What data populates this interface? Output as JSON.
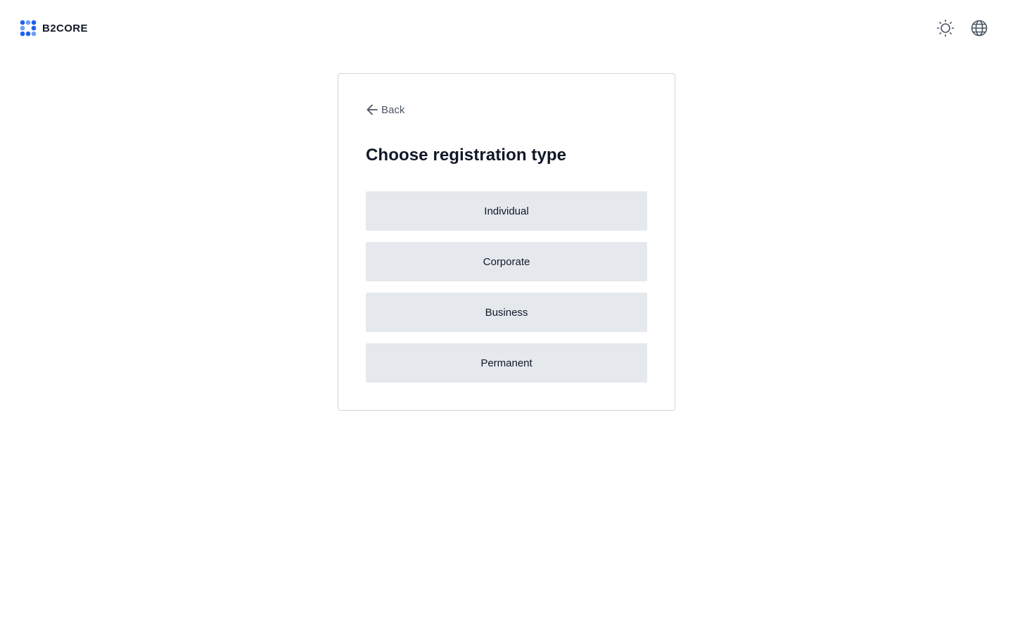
{
  "header": {
    "brand_name": "B2CORE",
    "brand_color": "#1d63f0",
    "icons": {
      "logo": "b2core-logo-icon",
      "theme": "sun-icon",
      "language": "globe-icon"
    }
  },
  "card": {
    "back_label": "Back",
    "back_icon": "arrow-left-icon",
    "title": "Choose registration type",
    "options": [
      {
        "label": "Individual"
      },
      {
        "label": "Corporate"
      },
      {
        "label": "Business"
      },
      {
        "label": "Permanent"
      }
    ]
  },
  "colors": {
    "button_background": "#e5e9ee",
    "card_border": "#d1d5db",
    "muted_text": "#4b5563",
    "text": "#111827"
  }
}
